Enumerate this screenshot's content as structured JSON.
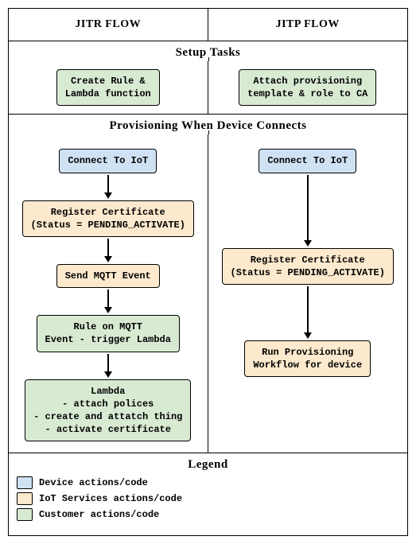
{
  "headers": {
    "jitr": "JITR FLOW",
    "jitp": "JITP FLOW"
  },
  "sections": {
    "setup": "Setup Tasks",
    "provisioning": "Provisioning When Device Connects",
    "legend": "Legend"
  },
  "setup": {
    "jitr": "Create Rule &\nLambda function",
    "jitp": "Attach provisioning\ntemplate & role to CA"
  },
  "flow": {
    "jitr": {
      "connect": "Connect To IoT",
      "register": "Register Certificate\n(Status = PENDING_ACTIVATE)",
      "mqtt": "Send MQTT Event",
      "rule": "Rule on MQTT\nEvent - trigger Lambda",
      "lambda": "Lambda\n- attach polices\n- create and attatch thing\n- activate certificate"
    },
    "jitp": {
      "connect": "Connect To IoT",
      "register": "Register Certificate\n(Status = PENDING_ACTIVATE)",
      "run": "Run Provisioning\nWorkflow for device"
    }
  },
  "legend": {
    "device": "Device actions/code",
    "iot": "IoT Services actions/code",
    "customer": "Customer actions/code"
  },
  "chart_data": {
    "type": "table",
    "title": "JITR vs JITP provisioning flow",
    "columns": [
      "JITR FLOW",
      "JITP FLOW"
    ],
    "legend": {
      "device": "Device actions/code",
      "iot": "IoT Services actions/code",
      "customer": "Customer actions/code"
    },
    "setup_tasks": {
      "JITR FLOW": {
        "label": "Create Rule & Lambda function",
        "actor": "customer"
      },
      "JITP FLOW": {
        "label": "Attach provisioning template & role to CA",
        "actor": "customer"
      }
    },
    "provisioning_steps": {
      "JITR FLOW": [
        {
          "label": "Connect To IoT",
          "actor": "device"
        },
        {
          "label": "Register Certificate (Status = PENDING_ACTIVATE)",
          "actor": "iot"
        },
        {
          "label": "Send MQTT Event",
          "actor": "iot"
        },
        {
          "label": "Rule on MQTT Event - trigger Lambda",
          "actor": "customer"
        },
        {
          "label": "Lambda - attach polices - create and attatch thing - activate certificate",
          "actor": "customer"
        }
      ],
      "JITP FLOW": [
        {
          "label": "Connect To IoT",
          "actor": "device"
        },
        {
          "label": "Register Certificate (Status = PENDING_ACTIVATE)",
          "actor": "iot"
        },
        {
          "label": "Run Provisioning Workflow for device",
          "actor": "iot"
        }
      ]
    }
  }
}
